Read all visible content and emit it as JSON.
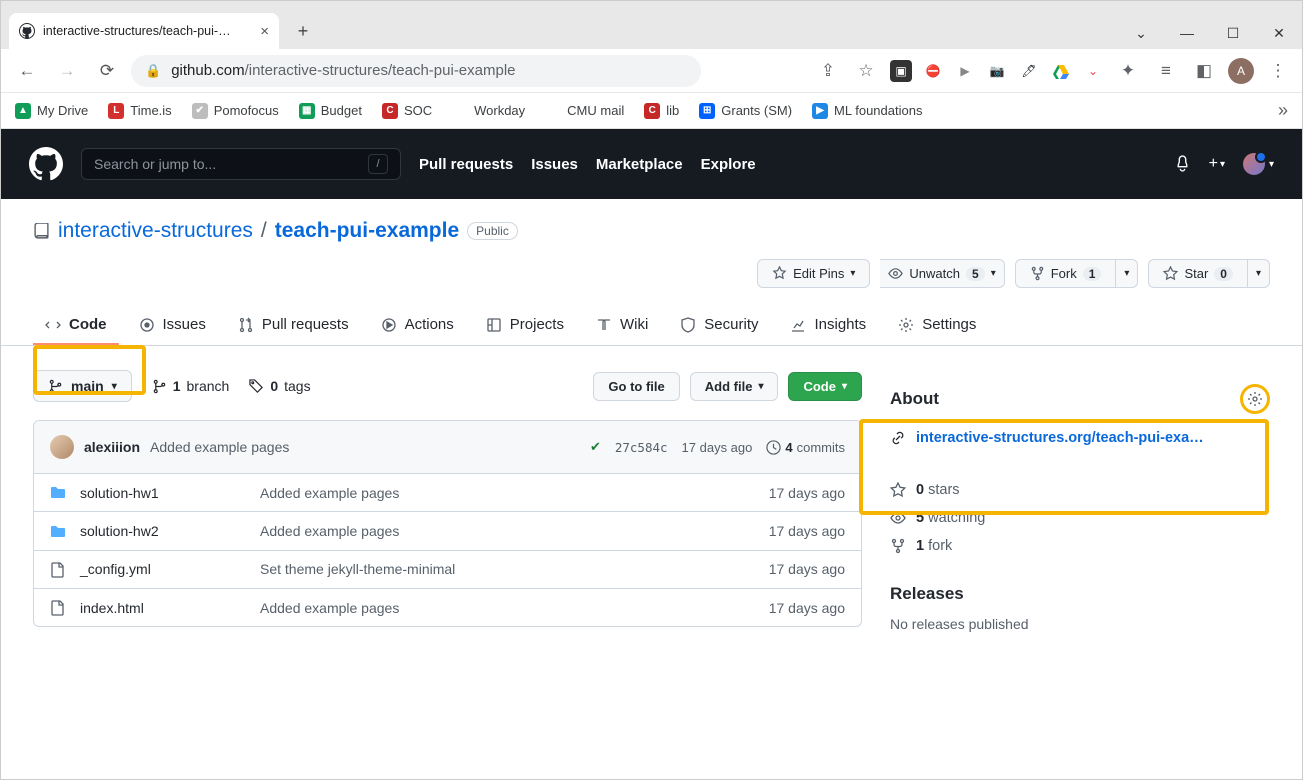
{
  "browser": {
    "tab_title": "interactive-structures/teach-pui-…",
    "url_domain": "github.com",
    "url_path": "/interactive-structures/teach-pui-example"
  },
  "bookmarks": [
    {
      "label": "My Drive",
      "color": "#0f9d58",
      "glyph": "▲"
    },
    {
      "label": "Time.is",
      "color": "#d32f2f",
      "glyph": "L"
    },
    {
      "label": "Pomofocus",
      "color": "#bdbdbd",
      "glyph": "✔"
    },
    {
      "label": "Budget",
      "color": "#0f9d58",
      "glyph": "▦"
    },
    {
      "label": "SOC",
      "color": "#c62828",
      "glyph": "C"
    },
    {
      "label": "Workday",
      "color": "#fff",
      "glyph": "W"
    },
    {
      "label": "CMU mail",
      "color": "#fff",
      "glyph": "M"
    },
    {
      "label": "lib",
      "color": "#c62828",
      "glyph": "C"
    },
    {
      "label": "Grants (SM)",
      "color": "#0061ff",
      "glyph": "⊞"
    },
    {
      "label": "ML foundations",
      "color": "#1e88e5",
      "glyph": "▶"
    }
  ],
  "gh_header": {
    "search_placeholder": "Search or jump to...",
    "nav": [
      "Pull requests",
      "Issues",
      "Marketplace",
      "Explore"
    ]
  },
  "repo": {
    "owner": "interactive-structures",
    "name": "teach-pui-example",
    "visibility": "Public",
    "actions": {
      "edit_pins": "Edit Pins",
      "unwatch": "Unwatch",
      "watch_count": "5",
      "fork": "Fork",
      "fork_count": "1",
      "star": "Star",
      "star_count": "0"
    },
    "tabs": [
      "Code",
      "Issues",
      "Pull requests",
      "Actions",
      "Projects",
      "Wiki",
      "Security",
      "Insights",
      "Settings"
    ]
  },
  "files": {
    "branch": "main",
    "branch_count": "1",
    "branch_label": "branch",
    "tag_count": "0",
    "tag_label": "tags",
    "goto": "Go to file",
    "addfile": "Add file",
    "codebtn": "Code",
    "commit": {
      "author": "alexiiion",
      "message": "Added example pages",
      "sha": "27c584c",
      "date": "17 days ago",
      "count": "4",
      "count_label": "commits"
    },
    "list": [
      {
        "type": "dir",
        "name": "solution-hw1",
        "msg": "Added example pages",
        "date": "17 days ago"
      },
      {
        "type": "dir",
        "name": "solution-hw2",
        "msg": "Added example pages",
        "date": "17 days ago"
      },
      {
        "type": "file",
        "name": "_config.yml",
        "msg": "Set theme jekyll-theme-minimal",
        "date": "17 days ago"
      },
      {
        "type": "file",
        "name": "index.html",
        "msg": "Added example pages",
        "date": "17 days ago"
      }
    ]
  },
  "about": {
    "title": "About",
    "link": "interactive-structures.org/teach-pui-exa…",
    "stars": "0",
    "stars_label": "stars",
    "watching": "5",
    "watching_label": "watching",
    "forks": "1",
    "forks_label": "fork"
  },
  "releases": {
    "title": "Releases",
    "text": "No releases published"
  }
}
